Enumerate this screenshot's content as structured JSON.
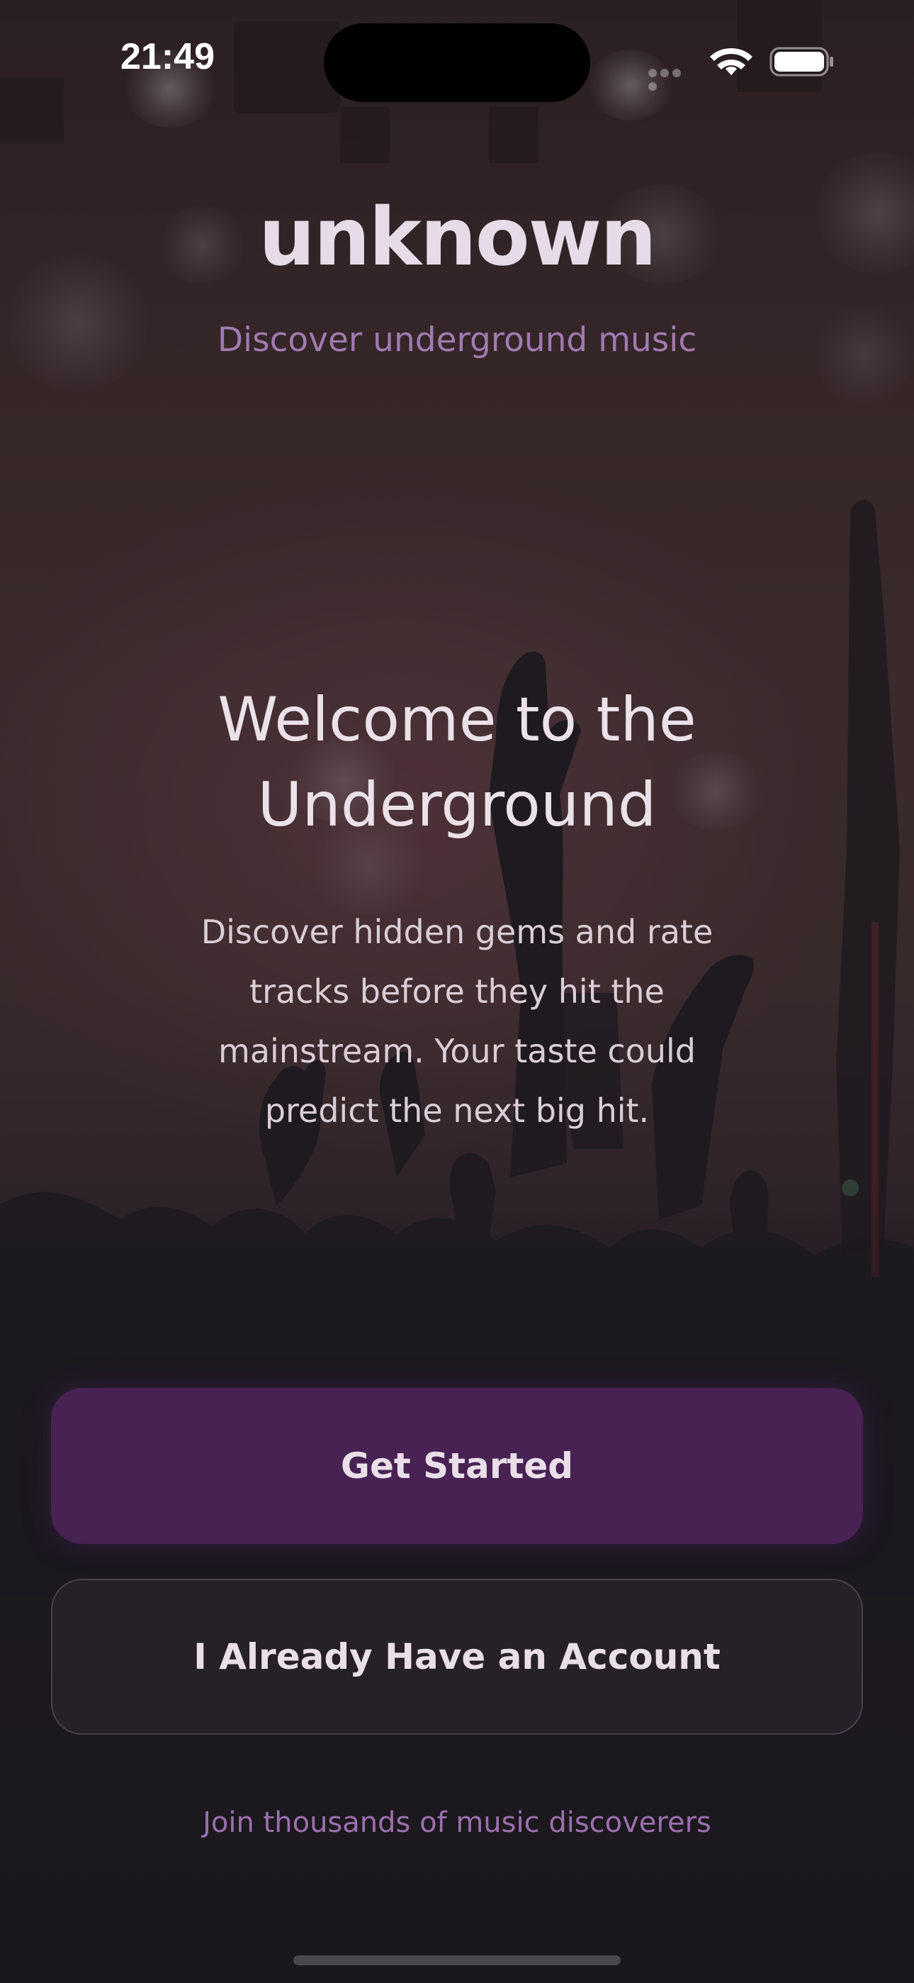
{
  "status_bar": {
    "time": "21:49",
    "icons": [
      "signal-dots-icon",
      "wifi-icon",
      "battery-icon"
    ]
  },
  "header": {
    "logo_text": "unknown",
    "tagline": "Discover underground music"
  },
  "welcome": {
    "title_line1": "Welcome to the",
    "title_line2": "Underground",
    "body_line1": "Discover hidden gems and rate",
    "body_line2": "tracks before they hit the",
    "body_line3": "mainstream. Your taste could",
    "body_line4": "predict the next big hit."
  },
  "actions": {
    "primary_label": "Get Started",
    "secondary_label": "I Already Have an Account"
  },
  "footer": {
    "note": "Join thousands of music discoverers"
  },
  "colors": {
    "accent": "#472253",
    "tagline": "#a07ab0",
    "background": "#1b181f"
  }
}
